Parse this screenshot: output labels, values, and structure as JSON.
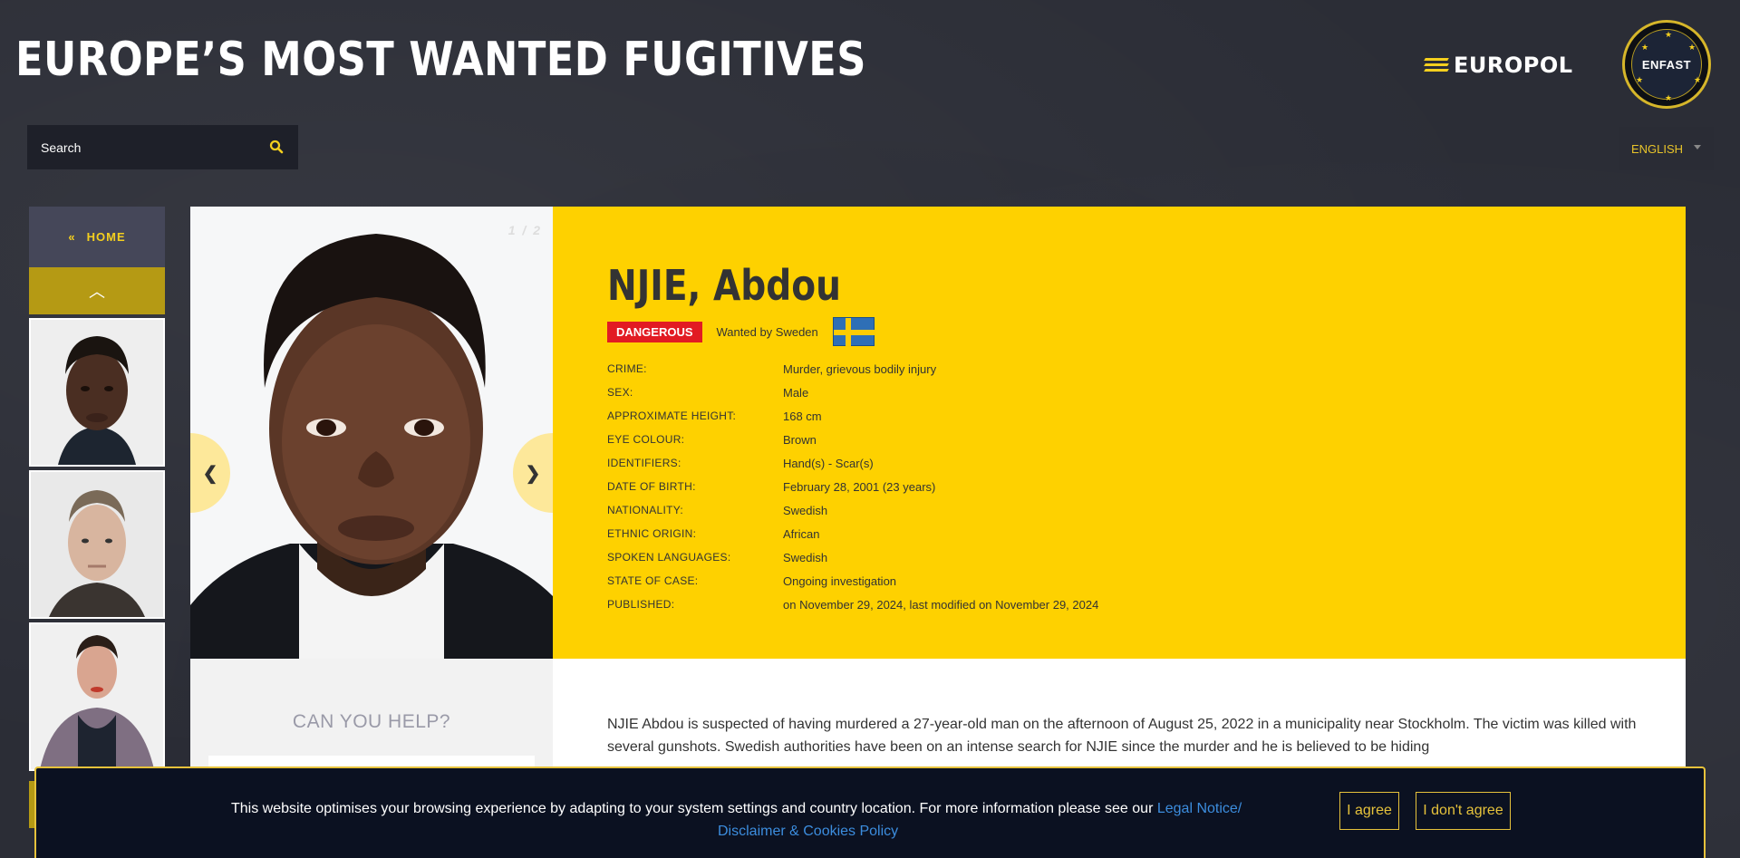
{
  "header": {
    "title": "EUROPE’S MOST WANTED FUGITIVES",
    "europol_logo": "EUROPOL",
    "enfast_logo": "ENFAST"
  },
  "search": {
    "placeholder": "Search",
    "value": ""
  },
  "language": {
    "selected": "ENGLISH"
  },
  "sidebar": {
    "home_label": "HOME",
    "thumbnails": [
      "fugitive-1",
      "fugitive-2",
      "fugitive-3"
    ]
  },
  "profile": {
    "photo_counter": "1 / 2",
    "name": "NJIE, Abdou",
    "badge": "DANGEROUS",
    "wanted_by": "Wanted by Sweden",
    "flag": "sweden-flag",
    "fields": [
      {
        "label": "CRIME:",
        "value": "Murder, grievous bodily injury"
      },
      {
        "label": "SEX:",
        "value": "Male"
      },
      {
        "label": "APPROXIMATE HEIGHT:",
        "value": "168 cm"
      },
      {
        "label": "EYE COLOUR:",
        "value": "Brown"
      },
      {
        "label": "IDENTIFIERS:",
        "value": "Hand(s) - Scar(s)"
      },
      {
        "label": "DATE OF BIRTH:",
        "value": "February 28, 2001 (23 years)"
      },
      {
        "label": "NATIONALITY:",
        "value": "Swedish"
      },
      {
        "label": "ETHNIC ORIGIN:",
        "value": "African"
      },
      {
        "label": "SPOKEN LANGUAGES:",
        "value": "Swedish"
      },
      {
        "label": "STATE OF CASE:",
        "value": "Ongoing investigation"
      },
      {
        "label": "PUBLISHED:",
        "value": "on November 29, 2024, last modified on November 29, 2024"
      }
    ]
  },
  "help": {
    "title": "CAN YOU HELP?"
  },
  "description": "NJIE Abdou is suspected of having murdered a 27-year-old man on the afternoon of August 25, 2022 in a municipality near Stockholm. The victim was killed with several gunshots. Swedish authorities have been on an intense search for NJIE since the murder and he is believed to be hiding",
  "cookie": {
    "text": "This website optimises your browsing experience by adapting to your system settings and country location. For more information please see our ",
    "link_part1": "Legal Notice/",
    "link_part2": "Disclaimer & Cookies Policy",
    "agree": "I agree",
    "disagree": "I don't agree"
  },
  "colors": {
    "accent_yellow": "#fed100",
    "danger_red": "#e21b23",
    "background": "#2b2d36",
    "cookie_bg": "#0b1121",
    "link_blue": "#3c8dde"
  }
}
